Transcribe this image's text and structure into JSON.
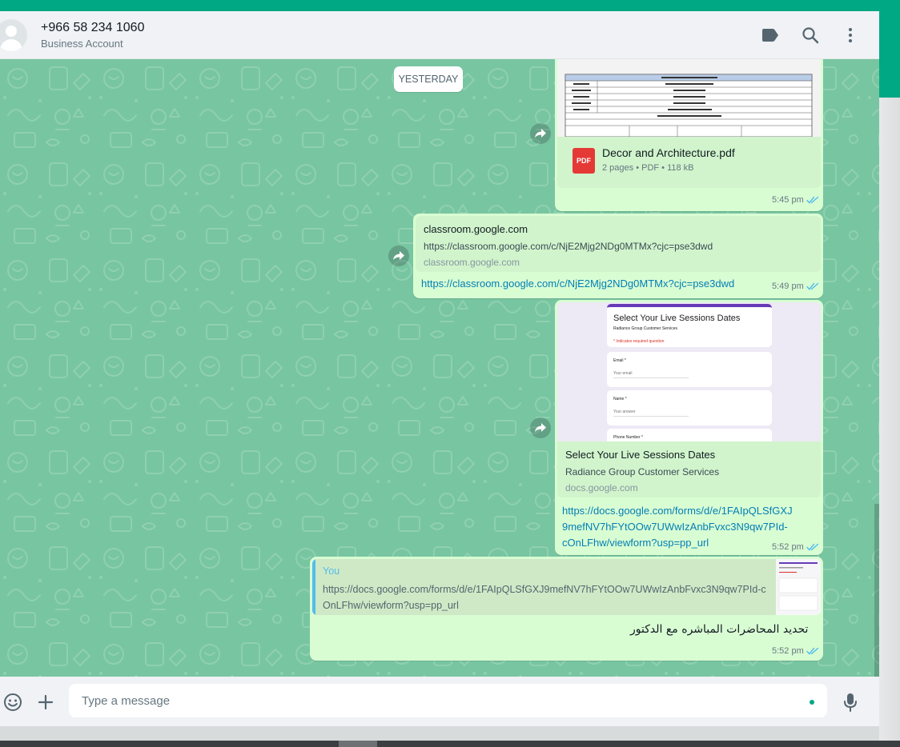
{
  "header": {
    "contact_name": "+966 58 234 1060",
    "contact_sub": "Business Account",
    "icons": [
      "label-icon",
      "search-icon",
      "menu-icon"
    ]
  },
  "chat": {
    "date_separator": "YESTERDAY",
    "messages": [
      {
        "type": "document",
        "file_name": "Decor and Architecture.pdf",
        "file_info": "2 pages • PDF • 118 kB",
        "file_badge": "PDF",
        "time": "5:45 pm",
        "forwarded": true
      },
      {
        "type": "link",
        "preview_title": "classroom.google.com",
        "preview_desc": "https://classroom.google.com/c/NjE2Mjg2NDg0MTMx?cjc=pse3dwd",
        "preview_domain": "classroom.google.com",
        "link": "https://classroom.google.com/c/NjE2Mjg2NDg0MTMx?cjc=pse3dwd",
        "time": "5:49 pm",
        "forwarded": true
      },
      {
        "type": "link",
        "preview_image": {
          "form_title": "Select Your Live Sessions Dates",
          "form_subtitle": "Radiance Group Customer Services",
          "required_note": "* Indicates required question",
          "fields": [
            {
              "label": "Email *",
              "placeholder": "Your email"
            },
            {
              "label": "Name *",
              "placeholder": "Your answer"
            },
            {
              "label": "Phone Number *",
              "placeholder": ""
            }
          ]
        },
        "preview_title": "Select Your Live Sessions Dates",
        "preview_desc": "Radiance Group Customer Services",
        "preview_domain": "docs.google.com",
        "link_lines": [
          "https://docs.google.com/forms/d/e/1FAIpQLSfGXJ",
          "9mefNV7hFYtOOw7UWwIzAnbFvxc3N9qw7PId-",
          "cOnLFhw/viewform?usp=pp_url"
        ],
        "time": "5:52 pm",
        "forwarded": true
      },
      {
        "type": "reply",
        "quote_author": "You",
        "quote_text": "https://docs.google.com/forms/d/e/1FAIpQLSfGXJ9mefNV7hFYtOOw7UWwIzAnbFvxc3N9qw7PId-cOnLFhw/viewform?usp=pp_url",
        "text": "تحديد المحاضرات المباشره مع الدكتور",
        "time": "5:52 pm"
      }
    ]
  },
  "footer": {
    "placeholder": "Type a message",
    "icons": [
      "emoji-icon",
      "plus-icon",
      "mic-icon"
    ]
  },
  "colors": {
    "accent": "#00a884",
    "chat_bg": "#78c5a1",
    "bubble_out": "#d9fdd3",
    "link": "#027eb5",
    "read_tick": "#53bdeb"
  }
}
